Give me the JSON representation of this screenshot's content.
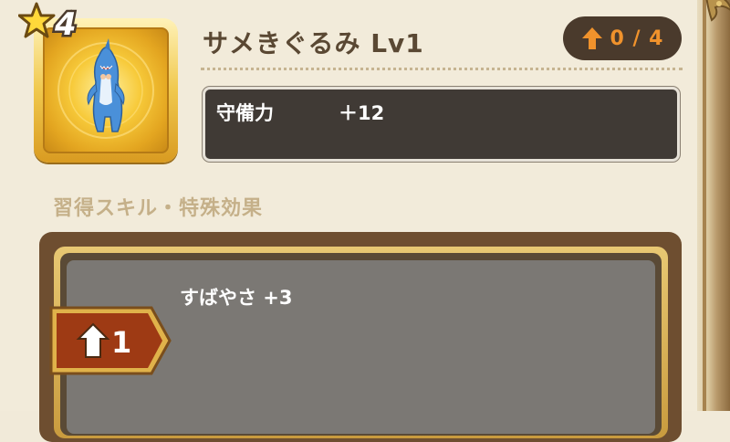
{
  "item": {
    "name": "サメきぐるみ Lv1",
    "star_rank": "4",
    "icon": "shark-costume-icon"
  },
  "upgrade": {
    "count": "0 / 4",
    "icon": "up-arrow-icon"
  },
  "stats": {
    "label": "守備力",
    "value": "＋12"
  },
  "skills": {
    "section_title": "習得スキル・特殊効果",
    "entries": [
      {
        "unlock_level": "1",
        "text": "すばやさ +3"
      }
    ]
  },
  "colors": {
    "accent_orange": "#f0922c",
    "panel_bg": "#f2ebda",
    "stat_box_bg": "#403a35"
  }
}
